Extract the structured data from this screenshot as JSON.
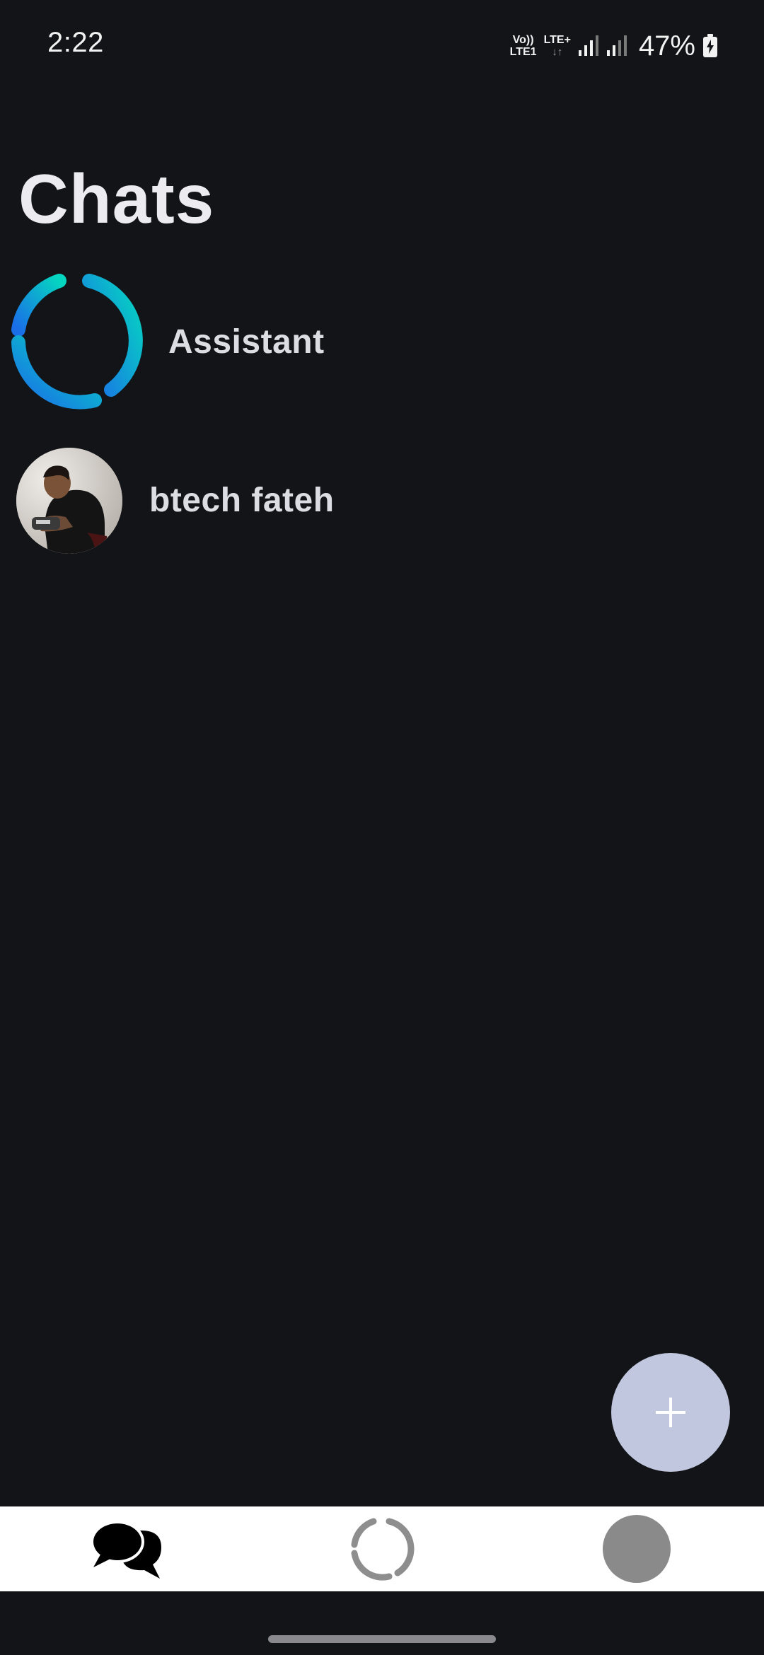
{
  "status_bar": {
    "time": "2:22",
    "volte_top": "Vo))",
    "volte_bottom": "LTE1",
    "network_type": "LTE+",
    "network_arrows": "↓↑",
    "battery_percent": "47%"
  },
  "header": {
    "title": "Chats"
  },
  "chats": [
    {
      "name": "Assistant",
      "avatar": "assistant-ring-icon"
    },
    {
      "name": "btech fateh",
      "avatar": "profile-photo"
    }
  ],
  "fab": {
    "icon": "plus-icon",
    "color": "#c0c7de"
  },
  "bottom_nav": {
    "items": [
      {
        "icon": "chats-icon",
        "active": true
      },
      {
        "icon": "updates-ring-icon",
        "active": false
      },
      {
        "icon": "profile-avatar-icon",
        "active": false
      }
    ]
  },
  "colors": {
    "background": "#131418",
    "assistant_gradient_start": "#05d6c0",
    "assistant_gradient_end": "#1a6fe8",
    "nav_background": "#ffffff"
  }
}
